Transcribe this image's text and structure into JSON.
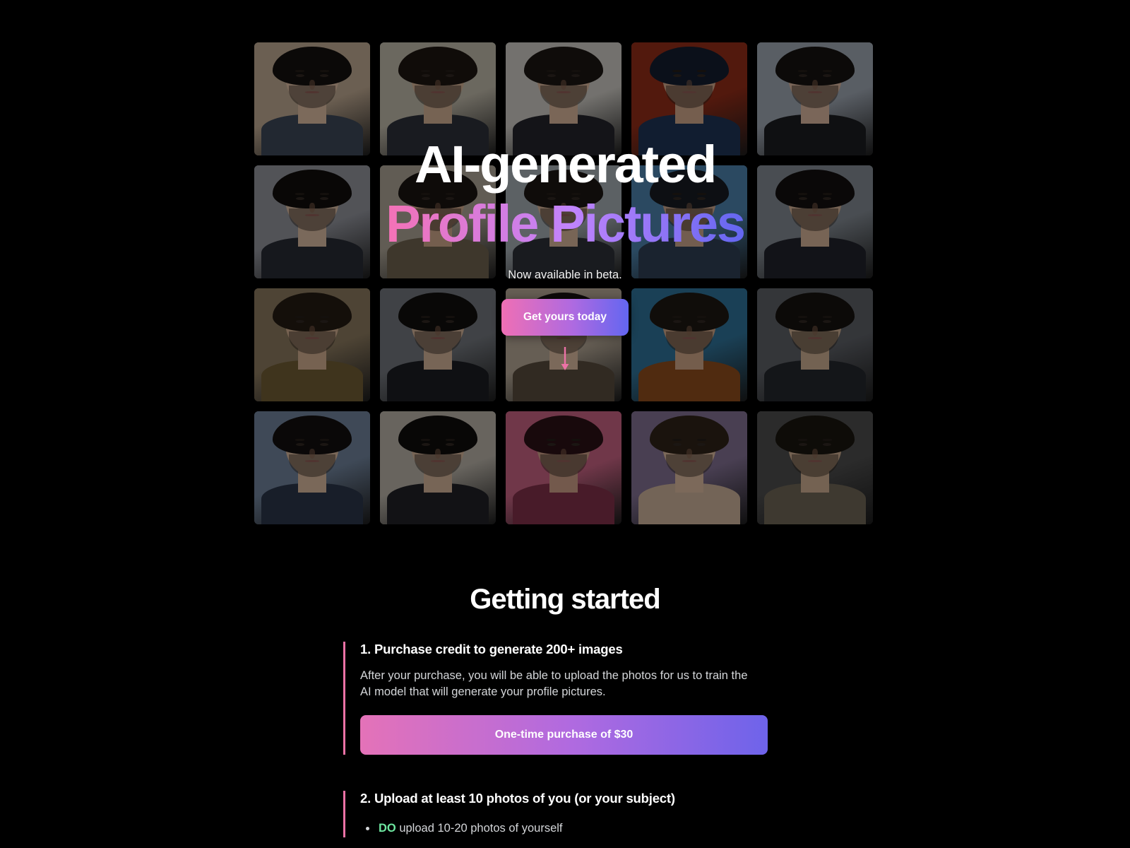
{
  "hero": {
    "headline_line1": "AI-generated",
    "headline_line2": "Profile Pictures",
    "subtitle": "Now available in beta.",
    "cta_label": "Get yours today",
    "scroll_arrow_icon": "arrow-down-icon",
    "gallery_alt": "gallery-of-ai-generated-portraits",
    "colors": {
      "gradient_start": "#f472b6",
      "gradient_mid": "#c084fc",
      "gradient_end": "#6366f1",
      "background": "#000000"
    },
    "tiles": [
      {
        "bg": "#b9a48d",
        "hair": "#14100e",
        "skin": "#d6b79e",
        "cloth": "#3b4555"
      },
      {
        "bg": "#b9b3a4",
        "hair": "#1d1511",
        "skin": "#cbab90",
        "cloth": "#8f8col"
      },
      {
        "bg": "#c6c3bd",
        "hair": "#1a1512",
        "skin": "#d3b096",
        "cloth": "#23242a"
      },
      {
        "bg": "#8e2b17",
        "hair": "#141c2e",
        "skin": "#caa287",
        "cloth": "#1e3354"
      },
      {
        "bg": "#9aa2ad",
        "hair": "#151210",
        "skin": "#d2b099",
        "cloth": "#1b1c20"
      },
      {
        "bg": "#8d8f97",
        "hair": "#100d0c",
        "skin": "#d2b59d",
        "cloth": "#272a33"
      },
      {
        "bg": "#a79f91",
        "hair": "#191310",
        "skin": "#c8a287",
        "cloth": "#6b5f4c"
      },
      {
        "bg": "#9fa7ad",
        "hair": "#1b1512",
        "skin": "#cfae94",
        "cloth": "#2b2f36"
      },
      {
        "bg": "#4a7fa8",
        "hair": "#171b22",
        "skin": "#c5a088",
        "cloth": "#2d3d52"
      },
      {
        "bg": "#7e858d",
        "hair": "#120f0e",
        "skin": "#cdac93",
        "cloth": "#20222a"
      },
      {
        "bg": "#87765c",
        "hair": "#231a12",
        "skin": "#cba98c",
        "cloth": "#6d5a33"
      },
      {
        "bg": "#6f7379",
        "hair": "#100e0d",
        "skin": "#cdae95",
        "cloth": "#1b1d22"
      },
      {
        "bg": "#b0a392",
        "hair": "#171210",
        "skin": "#d4b59c",
        "cloth": "#55493b"
      },
      {
        "bg": "#2e6f94",
        "hair": "#1d1712",
        "skin": "#c9a184",
        "cloth": "#8a4a1c"
      },
      {
        "bg": "#5a5d63",
        "hair": "#16120f",
        "skin": "#c7a98e",
        "cloth": "#24262b"
      },
      {
        "bg": "#6d7f97",
        "hair": "#120f0e",
        "skin": "#d3b39a",
        "cloth": "#2a3448"
      },
      {
        "bg": "#b3ada3",
        "hair": "#0f0d0c",
        "skin": "#cdae95",
        "cloth": "#1f2025"
      },
      {
        "bg": "#c2607f",
        "hair": "#2a1016",
        "skin": "#c79a83",
        "cloth": "#7d2f47"
      },
      {
        "bg": "#7e6d8e",
        "hair": "#2e2218",
        "skin": "#d6b59b",
        "cloth": "#c6ac96"
      },
      {
        "bg": "#4a4a4a",
        "hair": "#19150f",
        "skin": "#c9aa8e",
        "cloth": "#6b6254"
      }
    ]
  },
  "getting_started": {
    "title": "Getting started",
    "accent_color": "#ec72a6",
    "steps": [
      {
        "title": "1. Purchase credit to generate 200+ images",
        "body": "After your purchase, you will be able to upload the photos for us to train the AI model that will generate your profile pictures.",
        "button_label": "One-time purchase of $30"
      },
      {
        "title": "2. Upload at least 10 photos of you (or your subject)",
        "bullets": [
          {
            "emphasis": "DO",
            "text": " upload 10-20 photos of yourself"
          }
        ]
      }
    ]
  }
}
